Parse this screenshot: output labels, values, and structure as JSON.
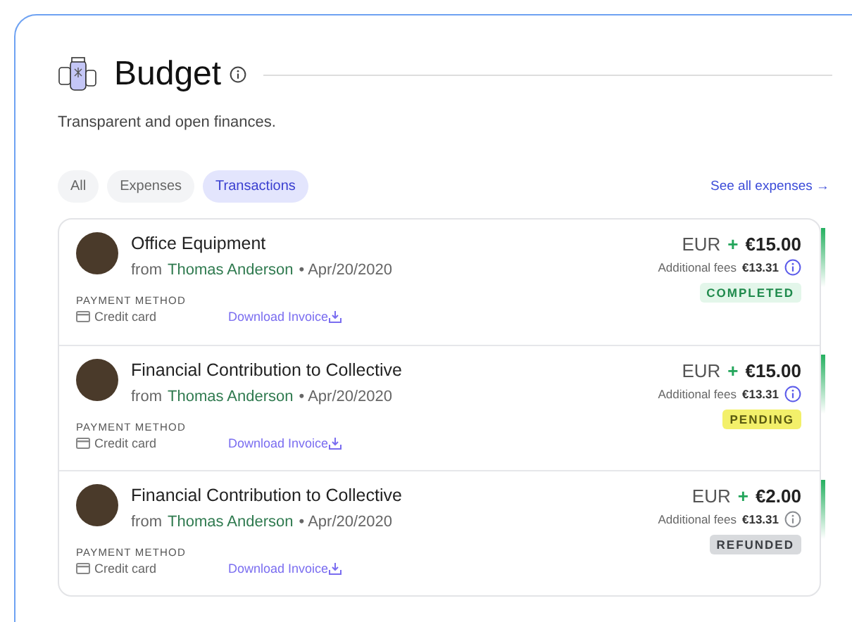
{
  "section": {
    "title": "Budget",
    "subtitle": "Transparent and open finances."
  },
  "tabs": [
    {
      "label": "All",
      "selected": false
    },
    {
      "label": "Expenses",
      "selected": false
    },
    {
      "label": "Transactions",
      "selected": true
    }
  ],
  "see_all_link": "See all expenses →",
  "transactions": [
    {
      "title": "Office Equipment",
      "from": "from",
      "author": "Thomas Anderson",
      "date": "• Apr/20/2020",
      "currency": "EUR",
      "sign": "+",
      "amount": "€15.00",
      "fees_label": "Additional fees",
      "fees": "€13.31",
      "status": "COMPLETED",
      "kind": "completed",
      "payment_label": "PAYMENT METHOD",
      "payment": "Credit card",
      "invoice_link": "Download Invoice"
    },
    {
      "title": "Financial Contribution to Collective",
      "from": "from",
      "author": "Thomas Anderson",
      "date": "• Apr/20/2020",
      "currency": "EUR",
      "sign": "+",
      "amount": "€15.00",
      "fees_label": "Additional fees",
      "fees": "€13.31",
      "status": "PENDING",
      "kind": "pending",
      "payment_label": "PAYMENT METHOD",
      "payment": "Credit card",
      "invoice_link": "Download Invoice"
    },
    {
      "title": "Financial Contribution to Collective",
      "from": "from",
      "author": "Thomas Anderson",
      "date": "• Apr/20/2020",
      "currency": "EUR",
      "sign": "+",
      "amount": "€2.00",
      "fees_label": "Additional fees",
      "fees": "€13.31",
      "status": "REFUNDED",
      "kind": "refunded",
      "payment_label": "PAYMENT METHOD",
      "payment": "Credit card",
      "invoice_link": "Download Invoice"
    }
  ]
}
